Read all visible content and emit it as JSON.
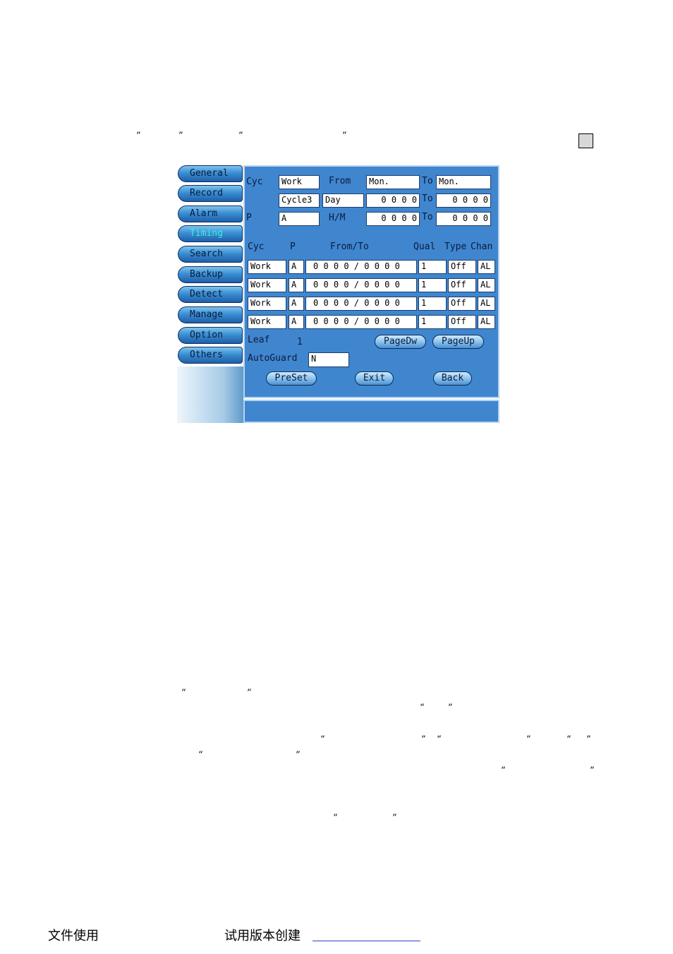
{
  "quote_marks": {
    "q1": "”",
    "q2": "”",
    "q3": "”",
    "q4": "”",
    "q5": "“",
    "q6": "”",
    "q7": "“",
    "q8": "”",
    "q9": "“",
    "q10": "”",
    "q11": "“",
    "q12": "”",
    "q13": "“",
    "q14": "”",
    "q15": "“",
    "q16": "”",
    "q17": "“",
    "q18": "”",
    "q19": "“",
    "q20": "”"
  },
  "sidebar": {
    "tabs": [
      {
        "label": "General"
      },
      {
        "label": "Record"
      },
      {
        "label": "Alarm"
      },
      {
        "label": "Timing"
      },
      {
        "label": "Search"
      },
      {
        "label": "Backup"
      },
      {
        "label": "Detect"
      },
      {
        "label": "Manage"
      },
      {
        "label": "Option"
      },
      {
        "label": "Others"
      }
    ],
    "active_color": "#38f0d8"
  },
  "form": {
    "cyc_label": "Cyc",
    "cyc_value": "Work",
    "from_label": "From",
    "from_value": "Mon.",
    "to_label": "To",
    "to_value": "Mon.",
    "cycle_value": "Cycle3",
    "unit_value": "Day",
    "date_from": "0 0 0 0",
    "to_label2": "To",
    "date_to": "0 0 0 0",
    "p_label": "P",
    "p_value": "A",
    "hm_label": "H/M",
    "hm_from": "0 0 0 0",
    "to_label3": "To",
    "hm_to": "0 0 0 0"
  },
  "table": {
    "headers": {
      "cyc": "Cyc",
      "p": "P",
      "fromto": "From/To",
      "qual": "Qual",
      "type": "Type",
      "chan": "Chan"
    },
    "rows": [
      {
        "cyc": "Work",
        "p": "A",
        "fromto": "0 0 0 0 / 0 0 0 0",
        "qual": "1",
        "type": "Off",
        "chan": "AL"
      },
      {
        "cyc": "Work",
        "p": "A",
        "fromto": "0 0 0 0 / 0 0 0 0",
        "qual": "1",
        "type": "Off",
        "chan": "AL"
      },
      {
        "cyc": "Work",
        "p": "A",
        "fromto": "0 0 0 0 / 0 0 0 0",
        "qual": "1",
        "type": "Off",
        "chan": "AL"
      },
      {
        "cyc": "Work",
        "p": "A",
        "fromto": "0 0 0 0 / 0 0 0 0",
        "qual": "1",
        "type": "Off",
        "chan": "AL"
      }
    ]
  },
  "paging": {
    "leaf_label": "Leaf",
    "leaf_value": "1",
    "pagedown_label": "PageDw",
    "pageup_label": "PageUp"
  },
  "autoguard": {
    "label": "AutoGuard",
    "value": "N"
  },
  "actions": {
    "preset_label": "PreSet",
    "exit_label": "Exit",
    "back_label": "Back"
  },
  "footer": {
    "left_text": "文件使用",
    "right_text": "试用版本创建"
  },
  "colors": {
    "panel_blue": "#3f86cf",
    "link_blue": "#2b3fd0"
  }
}
